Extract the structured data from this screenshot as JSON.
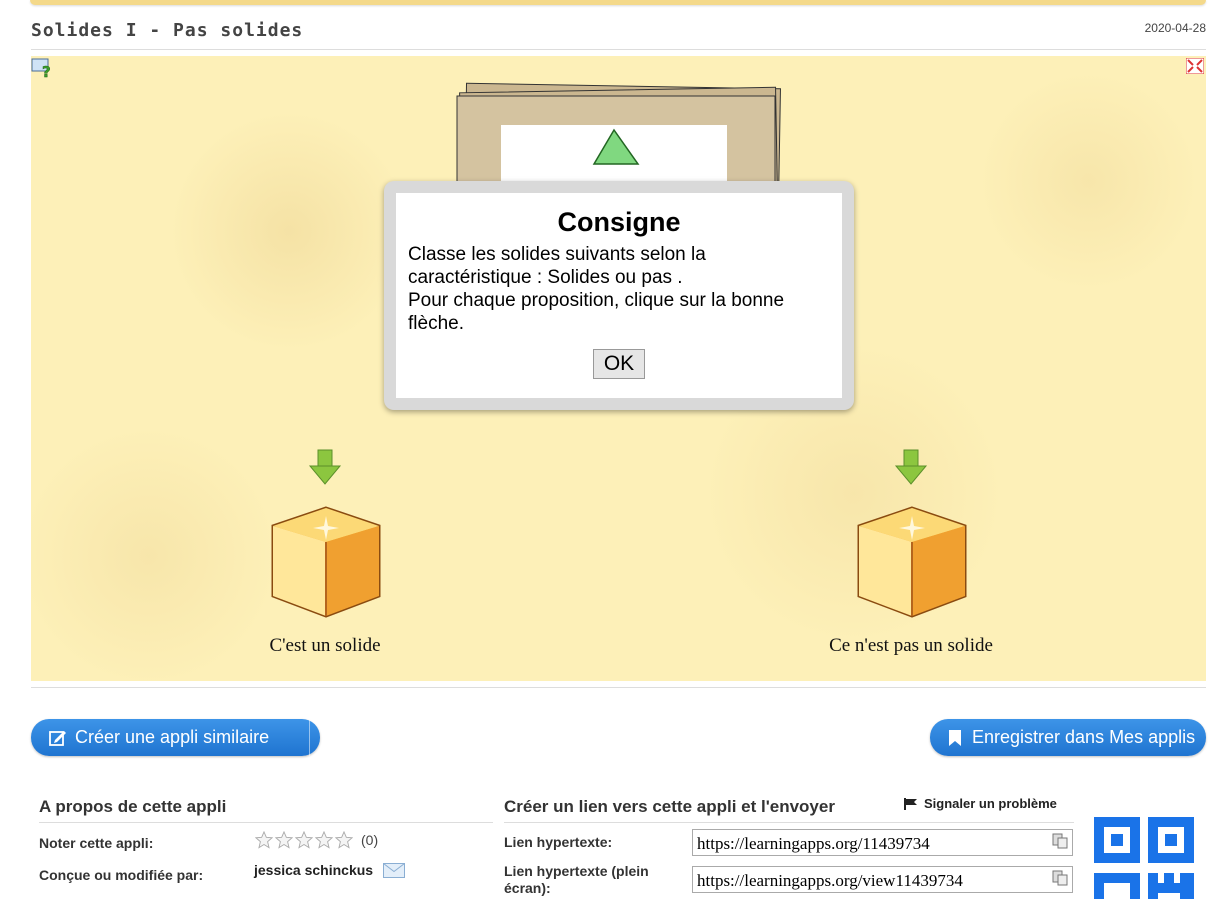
{
  "app": {
    "title": "Solides I - Pas solides",
    "date": "2020-04-28"
  },
  "modal": {
    "title": "Consigne",
    "line1": "Classe les solides suivants selon la caractéristique : Solides ou pas .",
    "line2": "Pour chaque proposition, clique sur la bonne flèche.",
    "ok_label": "OK"
  },
  "targets": [
    {
      "label": "C'est un solide"
    },
    {
      "label": "Ce n'est pas un solide"
    }
  ],
  "buttons": {
    "create_similar": "Créer une appli similaire",
    "save_to_my_apps": "Enregistrer dans Mes applis"
  },
  "about": {
    "title": "A propos de cette appli",
    "rate_label": "Noter cette appli:",
    "rating": 0,
    "rating_count": "(0)",
    "author_label": "Conçue ou modifiée par:",
    "author": "jessica schinckus"
  },
  "share": {
    "title": "Créer un lien vers cette appli et l'envoyer",
    "report_label": "Signaler un problème",
    "link_label": "Lien hypertexte:",
    "link_value": "https://learningapps.org/11439734",
    "fullscreen_label": "Lien hypertexte (plein écran):",
    "fullscreen_value": "https://learningapps.org/view11439734"
  },
  "colors": {
    "stage_background": "#fdf0b8",
    "button_blue": "#1f74d0",
    "arrow_green": "#8cc63f",
    "box_orange": "#f5a623"
  },
  "icons": [
    "help-icon",
    "fullscreen-icon",
    "arrow-down-icon",
    "box-icon",
    "edit-icon",
    "caret-down-icon",
    "bookmark-icon",
    "flag-icon",
    "mail-icon",
    "copy-icon",
    "star-icon"
  ]
}
